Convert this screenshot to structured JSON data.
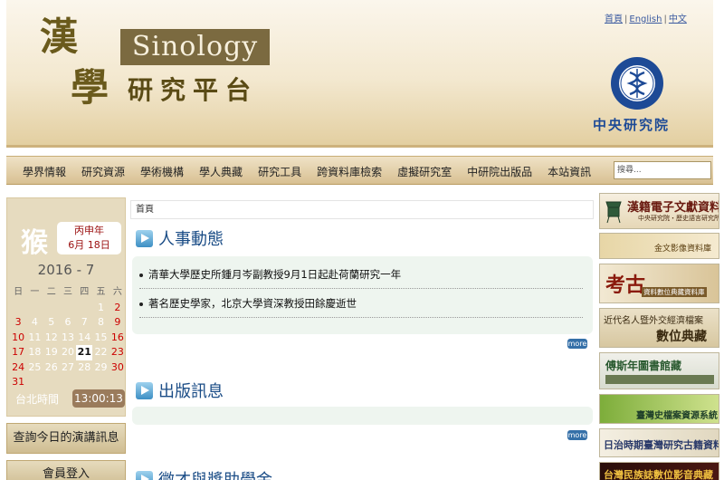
{
  "header": {
    "logo_kanji": [
      "漢",
      "學"
    ],
    "sinology": "Sinology",
    "platform": "研究平台",
    "toplinks": [
      "首頁",
      "English",
      "中文"
    ],
    "institution": "中央研究院"
  },
  "nav": {
    "items": [
      "學界情報",
      "研究資源",
      "學術機構",
      "學人典藏",
      "研究工具",
      "跨資料庫檢索",
      "虛擬研究室",
      "中研院出版品",
      "本站資訊"
    ],
    "search_placeholder": "搜尋..."
  },
  "calendar": {
    "zodiac": "猴",
    "lunar_year": "丙申年",
    "lunar_date": "6月 18日",
    "month_year": "2016 - 7",
    "weekdays": [
      "日",
      "一",
      "二",
      "三",
      "四",
      "五",
      "六"
    ],
    "weeks": [
      [
        "",
        "",
        "",
        "",
        "",
        "1",
        "2"
      ],
      [
        "3",
        "4",
        "5",
        "6",
        "7",
        "8",
        "9"
      ],
      [
        "10",
        "11",
        "12",
        "13",
        "14",
        "15",
        "16"
      ],
      [
        "17",
        "18",
        "19",
        "20",
        "21",
        "22",
        "23"
      ],
      [
        "24",
        "25",
        "26",
        "27",
        "28",
        "29",
        "30"
      ],
      [
        "31",
        "",
        "",
        "",
        "",
        "",
        ""
      ]
    ],
    "today": "21",
    "timezone_label": "台北時間",
    "time": "13:00:13"
  },
  "left_buttons": {
    "lecture": "查詢今日的演講訊息",
    "member": "會員登入"
  },
  "breadcrumb": "首頁",
  "sections": {
    "personnel": {
      "title": "人事動態",
      "items": [
        "清華大學歷史所鍾月岑副教授9月1日起赴荷蘭研究一年",
        "著名歷史學家，北京大學資深教授田餘慶逝世"
      ]
    },
    "publications": {
      "title": "出版訊息"
    },
    "third": {
      "title": "徵才與獎助學金"
    },
    "more_label": "more"
  },
  "banners": [
    {
      "title": "漢籍電子文獻資料庫",
      "sub": "中央研究院・歷史語言研究所"
    },
    {
      "title": "金文影像資料庫",
      "sub": ""
    },
    {
      "title": "考古",
      "sub": "資料數位典藏資料庫"
    },
    {
      "title": "近代名人暨外交經濟檔案",
      "sub": "數位典藏"
    },
    {
      "title": "傅斯年圖書館藏",
      "sub": ""
    },
    {
      "title": "臺灣史檔案資源系統",
      "sub": ""
    },
    {
      "title": "日治時期臺灣研究古籍資料庫",
      "sub": ""
    },
    {
      "title": "台灣民族誌數位影音典藏",
      "sub": ""
    }
  ]
}
